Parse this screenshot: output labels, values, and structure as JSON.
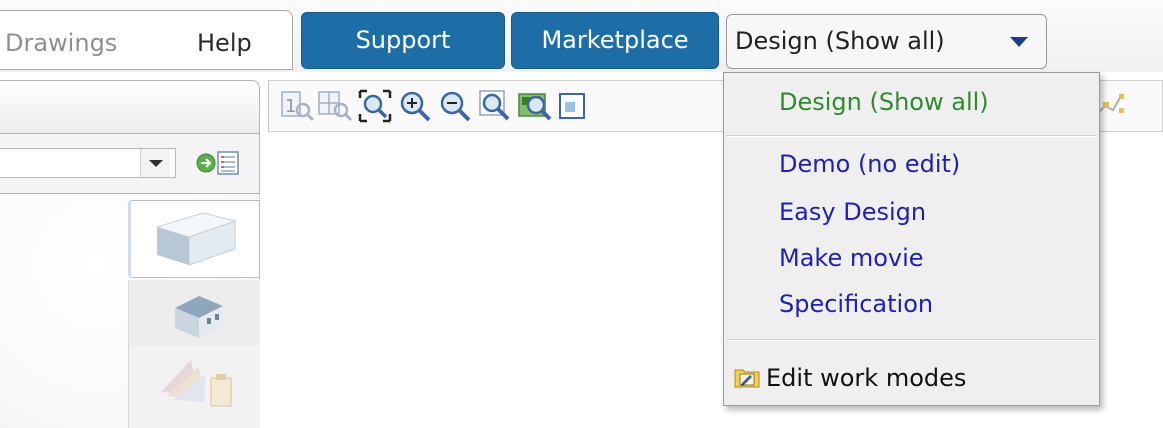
{
  "menubar": {
    "items": [
      {
        "label": "Drawings"
      },
      {
        "label": "Help"
      }
    ],
    "support_label": "Support",
    "marketplace_label": "Marketplace",
    "mode_selector": {
      "selected": "Design (Show all)"
    }
  },
  "mode_menu": {
    "current": "Design (Show all)",
    "options": [
      {
        "label": "Demo (no edit)"
      },
      {
        "label": "Easy Design"
      },
      {
        "label": "Make movie"
      },
      {
        "label": "Specification"
      }
    ],
    "edit_label": "Edit work modes"
  },
  "toolbar": {
    "icons": [
      "page-one-icon",
      "zoom-grid-icon",
      "zoom-extents-icon",
      "zoom-in-icon",
      "zoom-out-icon",
      "zoom-window-icon",
      "zoom-selection-icon",
      "window-frame-icon"
    ]
  },
  "left_panel": {
    "tabs": [
      "wall-3d-icon",
      "house-3d-icon",
      "color-palette-icon"
    ]
  },
  "colors": {
    "nav_button_blue": "#1d6ea6",
    "current_mode_green": "#2e8b2e",
    "mode_link_blue": "#1f1fb8",
    "caret_blue": "#1a3f8a",
    "dropdown_bg": "#efefef"
  }
}
